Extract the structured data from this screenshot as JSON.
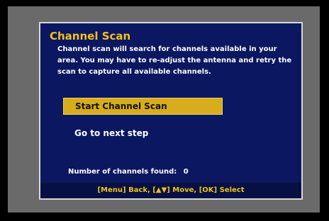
{
  "dialog": {
    "title": "Channel Scan",
    "description": "Channel scan will search for channels available in your area.  You may have to re-adjust the antenna and retry the scan to capture all available channels."
  },
  "menu": {
    "items": [
      {
        "label": "Start Channel Scan",
        "selected": true
      },
      {
        "label": "Go to next step",
        "selected": false
      }
    ]
  },
  "status": {
    "channels_found_label": "Number of channels found:",
    "channels_found_value": "0"
  },
  "help_bar": {
    "text": "[Menu] Back, [▲▼] Move, [OK] Select"
  },
  "colors": {
    "background": "#000000",
    "frame": "#6a6a6a",
    "dialog_bg": "#0b1760",
    "accent": "#f0c21a",
    "selected_bg": "#d7ac1d",
    "text": "#ffffff"
  }
}
